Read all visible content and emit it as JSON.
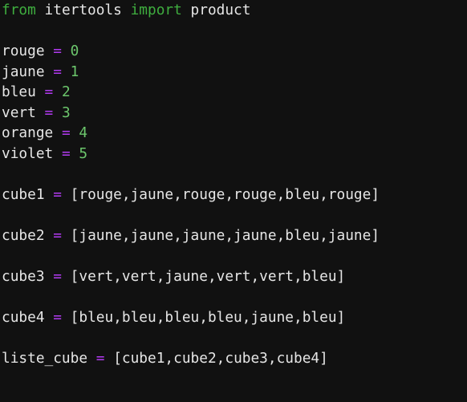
{
  "editor": {
    "colors": {
      "background": "#111111",
      "keyword": "#3fae3f",
      "operator": "#b33bf2",
      "number": "#6cc66c",
      "identifier": "#e6e6e6"
    },
    "lines": [
      {
        "tokens": [
          {
            "t": "kw",
            "v": "from"
          },
          {
            "t": "id",
            "v": " itertools "
          },
          {
            "t": "kw",
            "v": "import"
          },
          {
            "t": "id",
            "v": " product"
          }
        ]
      },
      {
        "tokens": []
      },
      {
        "tokens": [
          {
            "t": "id",
            "v": "rouge "
          },
          {
            "t": "op",
            "v": "="
          },
          {
            "t": "id",
            "v": " "
          },
          {
            "t": "num",
            "v": "0"
          }
        ]
      },
      {
        "tokens": [
          {
            "t": "id",
            "v": "jaune "
          },
          {
            "t": "op",
            "v": "="
          },
          {
            "t": "id",
            "v": " "
          },
          {
            "t": "num",
            "v": "1"
          }
        ]
      },
      {
        "tokens": [
          {
            "t": "id",
            "v": "bleu "
          },
          {
            "t": "op",
            "v": "="
          },
          {
            "t": "id",
            "v": " "
          },
          {
            "t": "num",
            "v": "2"
          }
        ]
      },
      {
        "tokens": [
          {
            "t": "id",
            "v": "vert "
          },
          {
            "t": "op",
            "v": "="
          },
          {
            "t": "id",
            "v": " "
          },
          {
            "t": "num",
            "v": "3"
          }
        ]
      },
      {
        "tokens": [
          {
            "t": "id",
            "v": "orange "
          },
          {
            "t": "op",
            "v": "="
          },
          {
            "t": "id",
            "v": " "
          },
          {
            "t": "num",
            "v": "4"
          }
        ]
      },
      {
        "tokens": [
          {
            "t": "id",
            "v": "violet "
          },
          {
            "t": "op",
            "v": "="
          },
          {
            "t": "id",
            "v": " "
          },
          {
            "t": "num",
            "v": "5"
          }
        ]
      },
      {
        "tokens": []
      },
      {
        "tokens": [
          {
            "t": "id",
            "v": "cube1 "
          },
          {
            "t": "op",
            "v": "="
          },
          {
            "t": "id",
            "v": " [rouge,jaune,rouge,rouge,bleu,rouge]"
          }
        ]
      },
      {
        "tokens": []
      },
      {
        "tokens": [
          {
            "t": "id",
            "v": "cube2 "
          },
          {
            "t": "op",
            "v": "="
          },
          {
            "t": "id",
            "v": " [jaune,jaune,jaune,jaune,bleu,jaune]"
          }
        ]
      },
      {
        "tokens": []
      },
      {
        "tokens": [
          {
            "t": "id",
            "v": "cube3 "
          },
          {
            "t": "op",
            "v": "="
          },
          {
            "t": "id",
            "v": " [vert,vert,jaune,vert,vert,bleu]"
          }
        ]
      },
      {
        "tokens": []
      },
      {
        "tokens": [
          {
            "t": "id",
            "v": "cube4 "
          },
          {
            "t": "op",
            "v": "="
          },
          {
            "t": "id",
            "v": " [bleu,bleu,bleu,bleu,jaune,bleu]"
          }
        ]
      },
      {
        "tokens": []
      },
      {
        "tokens": [
          {
            "t": "id",
            "v": "liste_cube "
          },
          {
            "t": "op",
            "v": "="
          },
          {
            "t": "id",
            "v": " [cube1,cube2,cube3,cube4]"
          }
        ]
      }
    ]
  }
}
